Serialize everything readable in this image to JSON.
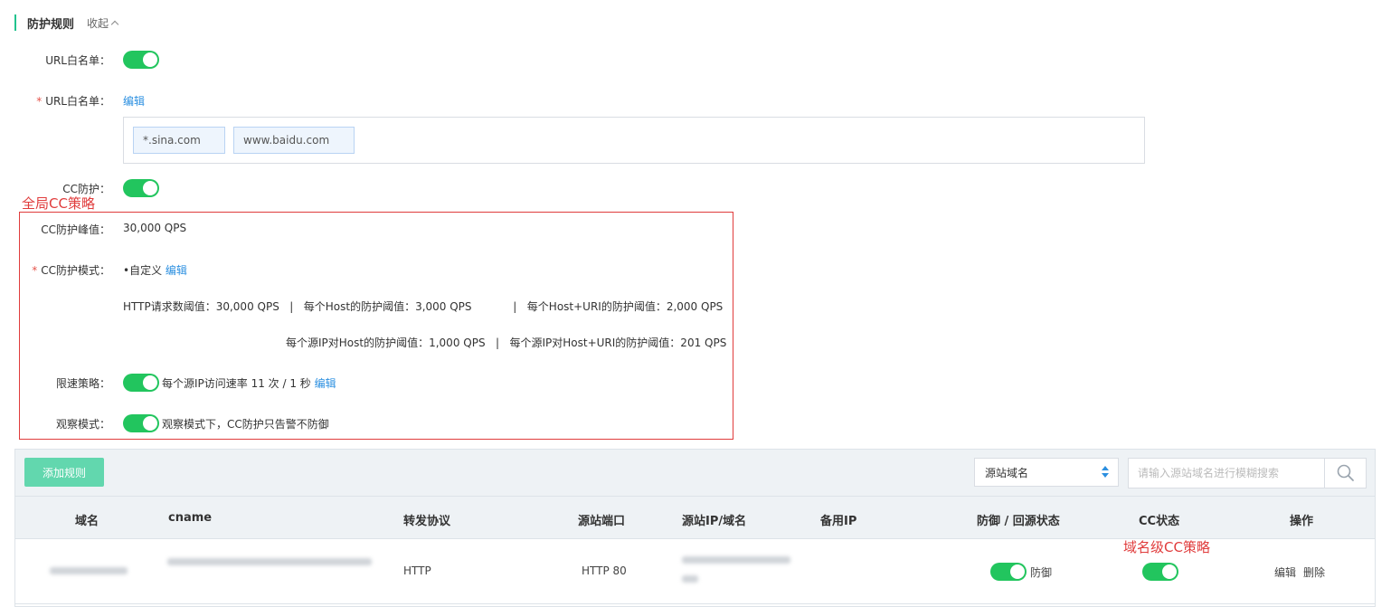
{
  "section": {
    "title": "防护规则",
    "collapse": "收起"
  },
  "url_whitelist": {
    "label": "URL白名单：",
    "enabled": true
  },
  "url_whitelist_edit": {
    "label": "URL白名单：",
    "edit": "编辑",
    "tags": [
      "*.sina.com",
      "www.baidu.com"
    ]
  },
  "cc_protect": {
    "label": "CC防护：",
    "enabled": true
  },
  "annotations": {
    "global": "全局CC策略",
    "domain": "域名级CC策略"
  },
  "cc_peak": {
    "label": "CC防护峰值：",
    "value": "30,000 QPS"
  },
  "cc_mode": {
    "label": "CC防护模式：",
    "value": "•自定义",
    "edit": "编辑",
    "line1": "HTTP请求数阈值：30,000 QPS   |   每个Host的防护阈值：3,000 QPS            |   每个Host+URI的防护阈值：2,000 QPS",
    "line2": "每个源IP对Host的防护阈值：1,000 QPS   |   每个源IP对Host+URI的防护阈值：201 QPS"
  },
  "rate_limit": {
    "label": "限速策略：",
    "enabled": true,
    "text": "每个源IP访问速率 11 次 / 1 秒",
    "edit": "编辑"
  },
  "observe": {
    "label": "观察模式：",
    "enabled": true,
    "text": "观察模式下，CC防护只告警不防御"
  },
  "toolbar": {
    "add": "添加规则",
    "select": "源站域名",
    "search_placeholder": "请输入源站域名进行模糊搜索"
  },
  "table": {
    "headers": {
      "domain": "域名",
      "cname": "cname",
      "protocol": "转发协议",
      "port": "源站端口",
      "origin": "源站IP/域名",
      "backup": "备用IP",
      "status": "防御 / 回源状态",
      "cc": "CC状态",
      "ops": "操作"
    },
    "rows": [
      {
        "protocol": "HTTP",
        "port": "HTTP 80",
        "status_label": "防御",
        "status_on": true,
        "cc_on": true,
        "edit": "编辑",
        "delete": "删除"
      }
    ]
  },
  "colors": {
    "accent": "#22c55e",
    "link": "#2b8fe0",
    "annotation": "#e03c3c",
    "button": "#62d7ae"
  }
}
